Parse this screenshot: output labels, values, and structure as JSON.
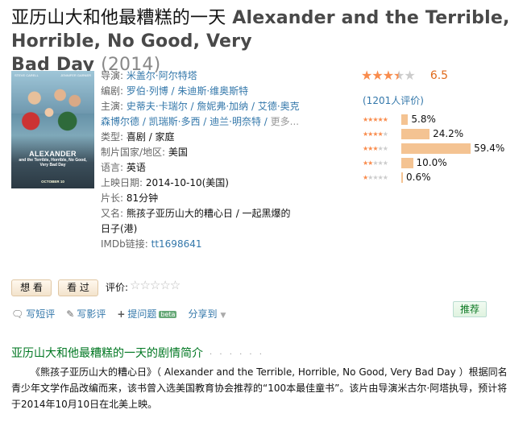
{
  "header": {
    "title_cn": "亚历山大和他最糟糕的一天",
    "title_en": "Alexander and the Terrible, Horrible, No Good, Very",
    "title_en2": "Bad Day",
    "year": "(2014)"
  },
  "poster": {
    "actor_left": "STEVE CARELL",
    "actor_right": "JENNIFER GARNER",
    "big_title": "ALEXANDER",
    "subtitle": "and the Terrible, Horrible, No Good, Very Bad Day",
    "date": "OCTOBER 10"
  },
  "info": {
    "director_label": "导演:",
    "director": "米盖尔·阿尔特塔",
    "writer_label": "编剧:",
    "writer": "罗伯·列博 / 朱迪斯·维奥斯特",
    "cast_label": "主演:",
    "cast_line1": "史蒂夫·卡瑞尔 / 詹妮弗·加纳 / 艾德·奥克",
    "cast_line2": "森博尔德 / 凯瑞斯·多西 / 迪兰·明奈特 / ",
    "cast_more": "更多...",
    "genre_label": "类型:",
    "genre": "喜剧 / 家庭",
    "country_label": "制片国家/地区:",
    "country": "美国",
    "language_label": "语言:",
    "language": "英语",
    "release_label": "上映日期:",
    "release": "2014-10-10(美国)",
    "runtime_label": "片长:",
    "runtime": "81分钟",
    "aka_label": "又名:",
    "aka": "熊孩子亚历山大的糟心日 / 一起黑爆的日子(港)",
    "imdb_label": "IMDb链接:",
    "imdb": "tt1698641"
  },
  "rating": {
    "score": "6.5",
    "stars": 3.5,
    "votes": "(1201人评价)",
    "distribution": [
      {
        "stars": 5,
        "pct": "5.8%",
        "value": 5.8
      },
      {
        "stars": 4,
        "pct": "24.2%",
        "value": 24.2
      },
      {
        "stars": 3,
        "pct": "59.4%",
        "value": 59.4
      },
      {
        "stars": 2,
        "pct": "10.0%",
        "value": 10.0
      },
      {
        "stars": 1,
        "pct": "0.6%",
        "value": 0.6
      }
    ]
  },
  "interest": {
    "want": "想 看",
    "seen": "看 过",
    "rate_label": "评价:"
  },
  "actions": {
    "short_review": "写短评",
    "review": "写影评",
    "question": "提问题",
    "beta": "beta",
    "share": "分享到",
    "recommend": "推荐"
  },
  "summary": {
    "heading": "亚历山大和他最糟糕的一天的剧情简介",
    "dots": "· · · · · ·",
    "text": "《熊孩子亚历山大的糟心日》（ Alexander and the Terrible, Horrible, No Good, Very Bad Day ）根据同名青少年文学作品改编而来，该书曾入选美国教育协会推荐的“100本最佳童书”。该片由导演米古尔·阿塔执导，预计将于2014年10月10日在北美上映。"
  }
}
